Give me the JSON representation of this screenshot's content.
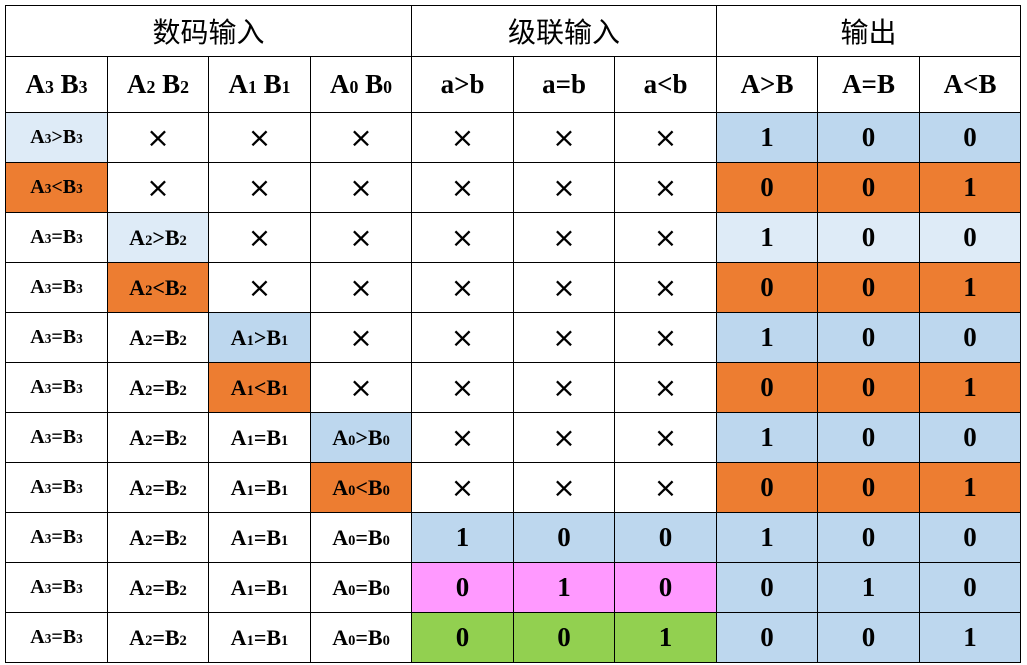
{
  "table": {
    "groups": [
      "数码输入",
      "级联输入",
      "输出"
    ],
    "headers": [
      [
        "A",
        "3",
        " B",
        "3"
      ],
      [
        "A",
        "2",
        " B",
        "2"
      ],
      [
        "A",
        "1",
        " B",
        "1"
      ],
      [
        "A",
        "0",
        " B",
        "0"
      ],
      "a>b",
      "a=b",
      "a<b",
      "A>B",
      "A=B",
      "A<B"
    ],
    "colors": {
      "blue": "#bdd7ee",
      "lightblue": "#deebf7",
      "orange": "#ed7d31",
      "pink": "#ff99ff",
      "green": "#92d050"
    },
    "rows": [
      [
        {
          "t": [
            "A",
            "3",
            ">B",
            "3"
          ],
          "c": "lightblue"
        },
        "×",
        "×",
        "×",
        "×",
        "×",
        "×",
        {
          "t": "1",
          "c": "blue"
        },
        {
          "t": "0",
          "c": "blue"
        },
        {
          "t": "0",
          "c": "blue"
        }
      ],
      [
        {
          "t": [
            "A",
            "3",
            "<B",
            "3"
          ],
          "c": "orange"
        },
        "×",
        "×",
        "×",
        "×",
        "×",
        "×",
        {
          "t": "0",
          "c": "orange"
        },
        {
          "t": "0",
          "c": "orange"
        },
        {
          "t": "1",
          "c": "orange"
        }
      ],
      [
        {
          "t": [
            "A",
            "3",
            "=B",
            "3"
          ]
        },
        {
          "t": [
            "A",
            "2",
            ">B",
            "2"
          ],
          "c": "lightblue"
        },
        "×",
        "×",
        "×",
        "×",
        "×",
        {
          "t": "1",
          "c": "lightblue"
        },
        {
          "t": "0",
          "c": "lightblue"
        },
        {
          "t": "0",
          "c": "lightblue"
        }
      ],
      [
        {
          "t": [
            "A",
            "3",
            "=B",
            "3"
          ]
        },
        {
          "t": [
            "A",
            "2",
            "<B",
            "2"
          ],
          "c": "orange"
        },
        "×",
        "×",
        "×",
        "×",
        "×",
        {
          "t": "0",
          "c": "orange"
        },
        {
          "t": "0",
          "c": "orange"
        },
        {
          "t": "1",
          "c": "orange"
        }
      ],
      [
        {
          "t": [
            "A",
            "3",
            "=B",
            "3"
          ]
        },
        {
          "t": [
            "A",
            "2",
            "=B",
            "2"
          ]
        },
        {
          "t": [
            "A",
            "1",
            ">B",
            "1"
          ],
          "c": "blue"
        },
        "×",
        "×",
        "×",
        "×",
        {
          "t": "1",
          "c": "blue"
        },
        {
          "t": "0",
          "c": "blue"
        },
        {
          "t": "0",
          "c": "blue"
        }
      ],
      [
        {
          "t": [
            "A",
            "3",
            "=B",
            "3"
          ]
        },
        {
          "t": [
            "A",
            "2",
            "=B",
            "2"
          ]
        },
        {
          "t": [
            "A",
            "1",
            "<B",
            "1"
          ],
          "c": "orange"
        },
        "×",
        "×",
        "×",
        "×",
        {
          "t": "0",
          "c": "orange"
        },
        {
          "t": "0",
          "c": "orange"
        },
        {
          "t": "1",
          "c": "orange"
        }
      ],
      [
        {
          "t": [
            "A",
            "3",
            "=B",
            "3"
          ]
        },
        {
          "t": [
            "A",
            "2",
            "=B",
            "2"
          ]
        },
        {
          "t": [
            "A",
            "1",
            "=B",
            "1"
          ]
        },
        {
          "t": [
            "A",
            "0",
            ">B",
            "0"
          ],
          "c": "blue"
        },
        "×",
        "×",
        "×",
        {
          "t": "1",
          "c": "blue"
        },
        {
          "t": "0",
          "c": "blue"
        },
        {
          "t": "0",
          "c": "blue"
        }
      ],
      [
        {
          "t": [
            "A",
            "3",
            "=B",
            "3"
          ]
        },
        {
          "t": [
            "A",
            "2",
            "=B",
            "2"
          ]
        },
        {
          "t": [
            "A",
            "1",
            "=B",
            "1"
          ]
        },
        {
          "t": [
            "A",
            "0",
            "<B",
            "0"
          ],
          "c": "orange"
        },
        "×",
        "×",
        "×",
        {
          "t": "0",
          "c": "orange"
        },
        {
          "t": "0",
          "c": "orange"
        },
        {
          "t": "1",
          "c": "orange"
        }
      ],
      [
        {
          "t": [
            "A",
            "3",
            "=B",
            "3"
          ]
        },
        {
          "t": [
            "A",
            "2",
            "=B",
            "2"
          ]
        },
        {
          "t": [
            "A",
            "1",
            "=B",
            "1"
          ]
        },
        {
          "t": [
            "A",
            "0",
            "=B",
            "0"
          ]
        },
        {
          "t": "1",
          "c": "blue"
        },
        {
          "t": "0",
          "c": "blue"
        },
        {
          "t": "0",
          "c": "blue"
        },
        {
          "t": "1",
          "c": "blue"
        },
        {
          "t": "0",
          "c": "blue"
        },
        {
          "t": "0",
          "c": "blue"
        }
      ],
      [
        {
          "t": [
            "A",
            "3",
            "=B",
            "3"
          ]
        },
        {
          "t": [
            "A",
            "2",
            "=B",
            "2"
          ]
        },
        {
          "t": [
            "A",
            "1",
            "=B",
            "1"
          ]
        },
        {
          "t": [
            "A",
            "0",
            "=B",
            "0"
          ]
        },
        {
          "t": "0",
          "c": "pink"
        },
        {
          "t": "1",
          "c": "pink"
        },
        {
          "t": "0",
          "c": "pink"
        },
        {
          "t": "0",
          "c": "blue"
        },
        {
          "t": "1",
          "c": "blue"
        },
        {
          "t": "0",
          "c": "blue"
        }
      ],
      [
        {
          "t": [
            "A",
            "3",
            "=B",
            "3"
          ]
        },
        {
          "t": [
            "A",
            "2",
            "=B",
            "2"
          ]
        },
        {
          "t": [
            "A",
            "1",
            "=B",
            "1"
          ]
        },
        {
          "t": [
            "A",
            "0",
            "=B",
            "0"
          ]
        },
        {
          "t": "0",
          "c": "green"
        },
        {
          "t": "0",
          "c": "green"
        },
        {
          "t": "1",
          "c": "green"
        },
        {
          "t": "0",
          "c": "blue"
        },
        {
          "t": "0",
          "c": "blue"
        },
        {
          "t": "1",
          "c": "blue"
        }
      ]
    ]
  }
}
